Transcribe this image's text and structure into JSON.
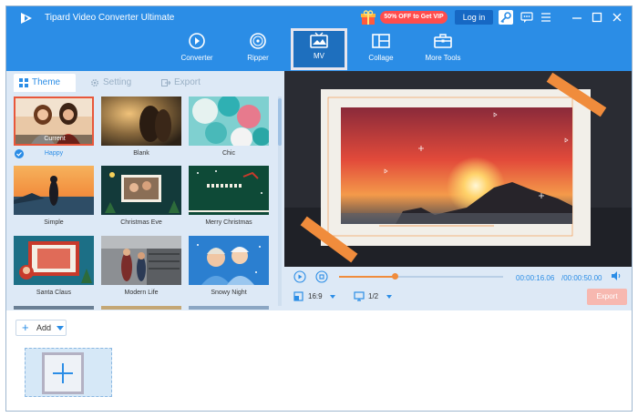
{
  "app": {
    "title": "Tipard Video Converter Ultimate"
  },
  "header": {
    "promo": "50% OFF to Get VIP",
    "login": "Log in",
    "icons": [
      "key-icon",
      "chat-icon",
      "menu-icon",
      "minimize-icon",
      "maximize-icon",
      "close-icon"
    ]
  },
  "toolbar": {
    "items": [
      {
        "label": "Converter",
        "icon": "converter-icon"
      },
      {
        "label": "Ripper",
        "icon": "ripper-icon"
      },
      {
        "label": "MV",
        "icon": "mv-icon"
      },
      {
        "label": "Collage",
        "icon": "collage-icon"
      },
      {
        "label": "More Tools",
        "icon": "toolbox-icon"
      }
    ],
    "active": "MV"
  },
  "tabs": [
    {
      "label": "Theme",
      "icon": "theme-icon"
    },
    {
      "label": "Setting",
      "icon": "gear-icon"
    },
    {
      "label": "Export",
      "icon": "export-icon"
    }
  ],
  "themes": {
    "current_badge": "Current",
    "items": [
      {
        "label": "Happy"
      },
      {
        "label": "Blank"
      },
      {
        "label": "Chic"
      },
      {
        "label": "Simple"
      },
      {
        "label": "Christmas Eve"
      },
      {
        "label": "Merry Christmas"
      },
      {
        "label": "Santa Claus"
      },
      {
        "label": "Modern Life"
      },
      {
        "label": "Snowy Night"
      }
    ]
  },
  "preview": {
    "time_current": "00:00:16.06",
    "time_total": "/00:00:50.00",
    "progress": 0.34,
    "aspect_ratio": "16:9",
    "page": "1/2",
    "export": "Export"
  },
  "bottom": {
    "add": "Add"
  },
  "colors": {
    "accent": "#2b8de6",
    "header": "#2b8de6",
    "promo": "#ff4d4d",
    "export_disabled": "#f7b8b0"
  }
}
